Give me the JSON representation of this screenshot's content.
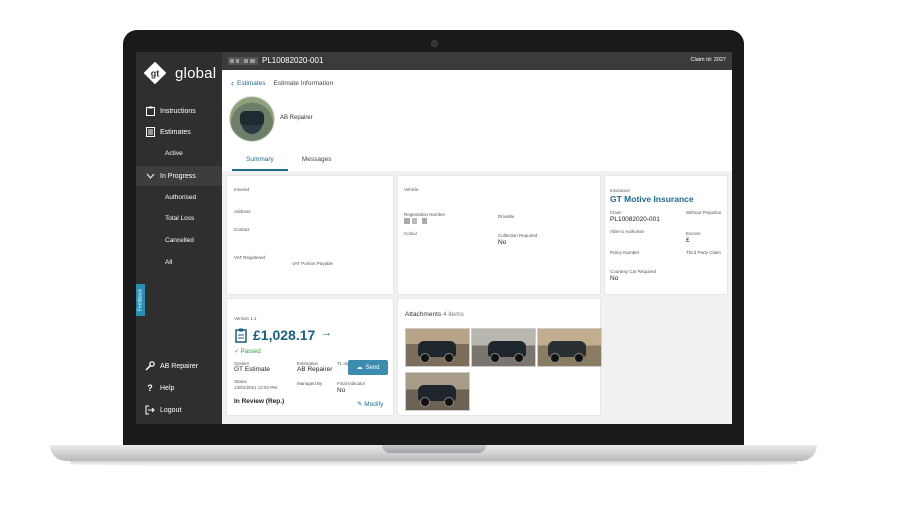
{
  "topbar": {
    "claim_number": "PL10082020-001",
    "claim_id": "Claim Id: 2027"
  },
  "sidebar": {
    "logo_mark": "gt",
    "logo_text": "global",
    "items": [
      {
        "label": "Instructions",
        "icon": "clipboard-icon"
      },
      {
        "label": "Estimates",
        "icon": "document-icon"
      },
      {
        "label": "Active"
      },
      {
        "label": "In Progress",
        "icon": "chevron-down-icon"
      },
      {
        "label": "Authorised"
      },
      {
        "label": "Total Loss"
      },
      {
        "label": "Cancelled"
      },
      {
        "label": "All"
      }
    ],
    "feedback": "Feedback",
    "bottom": [
      {
        "label": "AB Repairer",
        "icon": "wrench-icon"
      },
      {
        "label": "Help",
        "icon": "question-icon"
      },
      {
        "label": "Logout",
        "icon": "logout-icon"
      }
    ]
  },
  "breadcrumb": {
    "back": "Estimates",
    "current": "Estimate Information"
  },
  "header": {
    "repairer": "AB Repairer"
  },
  "tabs": [
    {
      "label": "Summary",
      "active": true
    },
    {
      "label": "Messages",
      "active": false
    }
  ],
  "customer": {
    "insured_label": "Insured",
    "address_label": "Address",
    "contact_label": "Contact",
    "vat_registered_label": "VAT Registered",
    "vat_portion_label": "VAT Portion Payable"
  },
  "vehicle": {
    "vehicle_label": "Vehicle",
    "registration_label": "Registration Number",
    "drivable_label": "Drivable",
    "colour_label": "Colour",
    "collection_label": "Collection Required",
    "collection_value": "No"
  },
  "insurance": {
    "label": "Insurance",
    "insurer": "GT Motive Insurance",
    "claim_label": "Claim",
    "claim_value": "PL10082020-001",
    "without_prejudice_label": "Without Prejudice",
    "able_label": "Able to Authorise",
    "excess_label": "Excess",
    "excess_value": "£",
    "policy_label": "Policy Number",
    "third_party_label": "Third Party Claim",
    "courtesy_label": "Courtesy Car Required",
    "courtesy_value": "No"
  },
  "estimate": {
    "version": "Version 1.1",
    "send_label": "Send",
    "amount": "£1,028.17",
    "arrow": "→",
    "status_text": "Passed",
    "system_label": "System",
    "system_value": "GT Estimate",
    "estimation_label": "Estimation",
    "estimation_value": "AB Repairer",
    "tl_label": "TL Indicator",
    "status_label": "Status",
    "status_date": "13/01/2021 12:02 PM",
    "managed_label": "Managed By",
    "final_label": "Final Indicator",
    "final_value": "No",
    "state": "In Review (Rep.)",
    "modify_label": "Modify"
  },
  "attachments": {
    "title": "Attachments",
    "count": "4 items"
  },
  "colors": {
    "sidebar": "#2f2f2f",
    "accent": "#1d6a8c",
    "send": "#3d8cb0",
    "passed": "#2e9a3a"
  }
}
